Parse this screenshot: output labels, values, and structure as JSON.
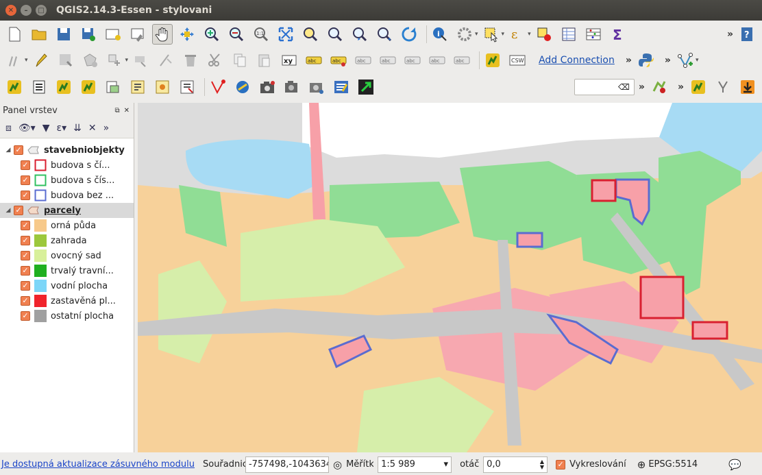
{
  "window": {
    "title": "QGIS2.14.3-Essen - stylovani"
  },
  "toolbar": {
    "add_connection": "Add Connection",
    "csw": "CSW",
    "xy": "xy",
    "abc": "abc"
  },
  "layers_panel": {
    "title": "Panel vrstev",
    "groups": [
      {
        "label": "stavebniobjekty",
        "items": [
          {
            "label": "budova s čí...",
            "color": "#d92030",
            "kind": "outline"
          },
          {
            "label": "budova s čís...",
            "color": "#30c060",
            "kind": "outline"
          },
          {
            "label": "budova bez ...",
            "color": "#5a6cd0",
            "kind": "outline"
          }
        ]
      },
      {
        "label": "parcely",
        "items": [
          {
            "label": "orná půda",
            "color": "#f7c98a",
            "kind": "fill"
          },
          {
            "label": "zahrada",
            "color": "#9cc83c",
            "kind": "fill"
          },
          {
            "label": "ovocný sad",
            "color": "#d8f09a",
            "kind": "fill"
          },
          {
            "label": "trvalý travní...",
            "color": "#20b020",
            "kind": "fill"
          },
          {
            "label": "vodní plocha",
            "color": "#7cd6f8",
            "kind": "fill"
          },
          {
            "label": "zastavěná pl...",
            "color": "#f0242c",
            "kind": "fill"
          },
          {
            "label": "ostatní plocha",
            "color": "#a0a0a0",
            "kind": "fill"
          }
        ]
      }
    ]
  },
  "statusbar": {
    "plugin_update": "Je dostupná aktualizace zásuvného modulu",
    "coord_label": "Souřadnice",
    "coord_value": "-757498,-1043634",
    "scale_label": "Měřítko",
    "scale_value": "1:5 989",
    "rotation_label": "otáčení",
    "rotation_value": "0,0",
    "render_label": "Vykreslování",
    "crs": "EPSG:5514"
  }
}
